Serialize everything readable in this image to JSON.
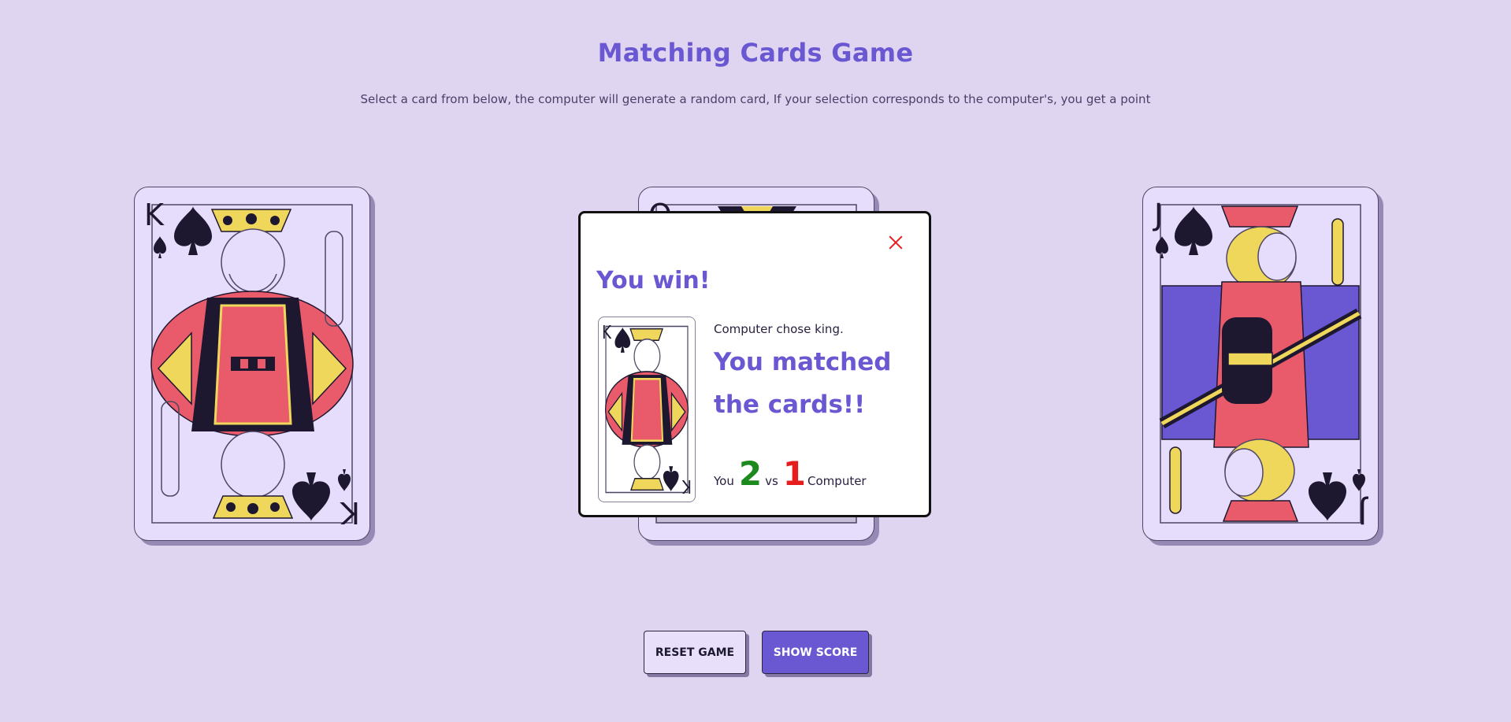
{
  "header": {
    "title": "Matching Cards Game",
    "subtitle": "Select a card from below, the computer will generate a random card, If your selection corresponds to the computer's, you get a point"
  },
  "cards": [
    {
      "rank": "K",
      "suit": "spade",
      "name": "king"
    },
    {
      "rank": "Q",
      "suit": "spade",
      "name": "queen"
    },
    {
      "rank": "J",
      "suit": "spade",
      "name": "jack"
    }
  ],
  "modal": {
    "heading": "You win!",
    "computer_choice": "Computer chose king.",
    "message": "You matched the cards!!",
    "score_you_label": "You",
    "score_you": "2",
    "score_vs": "vs",
    "score_computer": "1",
    "score_computer_label": "Computer"
  },
  "buttons": {
    "reset": "RESET GAME",
    "show_score": "SHOW SCORE"
  },
  "colors": {
    "background": "#dfd5f1",
    "accent": "#6a58d2",
    "win_green": "#1d8a1d",
    "lose_red": "#e51d1d",
    "card_face": "#e6dcfb"
  }
}
